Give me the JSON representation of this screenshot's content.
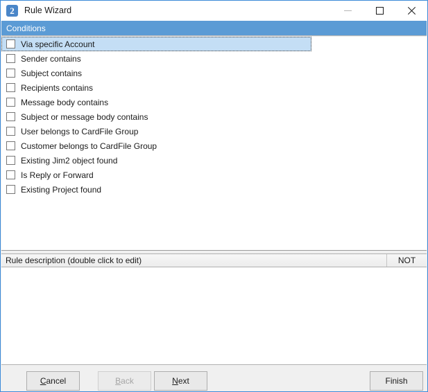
{
  "window": {
    "title": "Rule Wizard",
    "icon": "jim2-app-icon",
    "accent_color": "#5b9bd5",
    "border_color": "#3b8ad8",
    "controls": {
      "minimize": "minimize-icon",
      "maximize": "maximize-icon",
      "close": "close-icon"
    }
  },
  "conditions": {
    "header": "Conditions",
    "items": [
      {
        "label": "Via specific Account",
        "checked": false,
        "selected": true
      },
      {
        "label": "Sender contains",
        "checked": false,
        "selected": false
      },
      {
        "label": "Subject contains",
        "checked": false,
        "selected": false
      },
      {
        "label": "Recipients contains",
        "checked": false,
        "selected": false
      },
      {
        "label": "Message body contains",
        "checked": false,
        "selected": false
      },
      {
        "label": "Subject or message body contains",
        "checked": false,
        "selected": false
      },
      {
        "label": "User belongs to CardFile Group",
        "checked": false,
        "selected": false
      },
      {
        "label": "Customer belongs to CardFile Group",
        "checked": false,
        "selected": false
      },
      {
        "label": "Existing Jim2 object found",
        "checked": false,
        "selected": false
      },
      {
        "label": "Is Reply or Forward",
        "checked": false,
        "selected": false
      },
      {
        "label": "Existing Project found",
        "checked": false,
        "selected": false
      }
    ]
  },
  "description_grid": {
    "title_column": "Rule description (double click to edit)",
    "not_column": "NOT",
    "rows": []
  },
  "buttons": {
    "cancel": {
      "pre": "",
      "acc": "C",
      "post": "ancel",
      "enabled": true
    },
    "back": {
      "pre": "",
      "acc": "B",
      "post": "ack",
      "enabled": false
    },
    "next": {
      "pre": "",
      "acc": "N",
      "post": "ext",
      "enabled": true
    },
    "finish": {
      "label": "Finish",
      "enabled": true
    }
  }
}
